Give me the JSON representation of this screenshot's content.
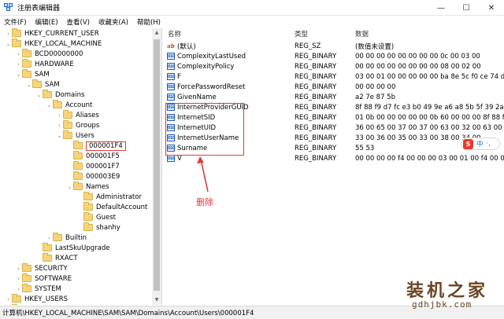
{
  "window": {
    "title": "注册表编辑器",
    "minimize": "—",
    "maximize": "☐",
    "close": "✕"
  },
  "menu": [
    "文件(F)",
    "编辑(E)",
    "查看(V)",
    "收藏夹(A)",
    "帮助(H)"
  ],
  "tree": [
    {
      "label": "HKEY_CURRENT_USER",
      "level": 1,
      "arrow": "›"
    },
    {
      "label": "HKEY_LOCAL_MACHINE",
      "level": 1,
      "arrow": "⌄"
    },
    {
      "label": "BCD00000000",
      "level": 2,
      "arrow": "›"
    },
    {
      "label": "HARDWARE",
      "level": 2,
      "arrow": "›"
    },
    {
      "label": "SAM",
      "level": 2,
      "arrow": "⌄"
    },
    {
      "label": "SAM",
      "level": 3,
      "arrow": "⌄"
    },
    {
      "label": "Domains",
      "level": 4,
      "arrow": "⌄"
    },
    {
      "label": "Account",
      "level": 5,
      "arrow": "⌄"
    },
    {
      "label": "Aliases",
      "level": 6,
      "arrow": "›"
    },
    {
      "label": "Groups",
      "level": 6,
      "arrow": "›"
    },
    {
      "label": "Users",
      "level": 6,
      "arrow": "⌄"
    },
    {
      "label": "000001F4",
      "level": 7,
      "arrow": "",
      "selected": true
    },
    {
      "label": "000001F5",
      "level": 7,
      "arrow": ""
    },
    {
      "label": "000001F7",
      "level": 7,
      "arrow": ""
    },
    {
      "label": "000003E9",
      "level": 7,
      "arrow": ""
    },
    {
      "label": "Names",
      "level": 7,
      "arrow": "⌄"
    },
    {
      "label": "Administrator",
      "level": 8,
      "arrow": ""
    },
    {
      "label": "DefaultAccount",
      "level": 8,
      "arrow": ""
    },
    {
      "label": "Guest",
      "level": 8,
      "arrow": ""
    },
    {
      "label": "shanhy",
      "level": 8,
      "arrow": ""
    },
    {
      "label": "Builtin",
      "level": 5,
      "arrow": "›"
    },
    {
      "label": "LastSkuUpgrade",
      "level": 4,
      "arrow": ""
    },
    {
      "label": "RXACT",
      "level": 4,
      "arrow": ""
    },
    {
      "label": "SECURITY",
      "level": 2,
      "arrow": "›"
    },
    {
      "label": "SOFTWARE",
      "level": 2,
      "arrow": "›"
    },
    {
      "label": "SYSTEM",
      "level": 2,
      "arrow": "›"
    },
    {
      "label": "HKEY_USERS",
      "level": 1,
      "arrow": "›"
    },
    {
      "label": "HKEY_CURRENT_CONFIG",
      "level": 1,
      "arrow": "›"
    }
  ],
  "list": {
    "headers": {
      "name": "名称",
      "type": "类型",
      "data": "数据"
    },
    "rows": [
      {
        "icon": "ab",
        "name": "(默认)",
        "type": "REG_SZ",
        "data": "(数值未设置)"
      },
      {
        "icon": "bin",
        "name": "ComplexityLastUsed",
        "type": "REG_BINARY",
        "data": "00 00 00 00 00 00 00 00 0c 00 03 00"
      },
      {
        "icon": "bin",
        "name": "ComplexityPolicy",
        "type": "REG_BINARY",
        "data": "00 00 00 00 00 00 00 00 08 00 02 00"
      },
      {
        "icon": "bin",
        "name": "F",
        "type": "REG_BINARY",
        "data": "03 00 01 00 00 00 00 00 ba 8e 5c f0 ce 74 d5..."
      },
      {
        "icon": "bin",
        "name": "ForcePasswordReset",
        "type": "REG_BINARY",
        "data": "00 00 00 00"
      },
      {
        "icon": "bin",
        "name": "GivenName",
        "type": "REG_BINARY",
        "data": "a2 7e 87 5b"
      },
      {
        "icon": "bin",
        "name": "InternetProviderGUID",
        "type": "REG_BINARY",
        "data": "8f 88 f9 d7 fc e3 b0 49 9e a6 a8 5b 5f 39 2a 4f"
      },
      {
        "icon": "bin",
        "name": "InternetSID",
        "type": "REG_BINARY",
        "data": "01 0b 00 00 00 00 00 0b 60 00 00 00 8f 88 f9 d..."
      },
      {
        "icon": "bin",
        "name": "InternetUID",
        "type": "REG_BINARY",
        "data": "36 00 65 00 37 00 37 00 63 00 32 00 63 00 3..."
      },
      {
        "icon": "bin",
        "name": "InternetUserName",
        "type": "REG_BINARY",
        "data": "33 00 36 00 35 00 33 00 38 00 34 00"
      },
      {
        "icon": "bin",
        "name": "Surname",
        "type": "REG_BINARY",
        "data": "55 53"
      },
      {
        "icon": "bin",
        "name": "V",
        "type": "REG_BINARY",
        "data": "00 00 00 00 f4 00 00 00 03 00 01 00 f4 00 00..."
      }
    ]
  },
  "annotation": "删除",
  "ime": {
    "logo": "S",
    "mode": "中",
    "extra": "·,"
  },
  "statusbar": "计算机\\HKEY_LOCAL_MACHINE\\SAM\\SAM\\Domains\\Account\\Users\\000001F4",
  "watermark": {
    "main": "装机之家",
    "sub": "gdhjbk.com"
  }
}
